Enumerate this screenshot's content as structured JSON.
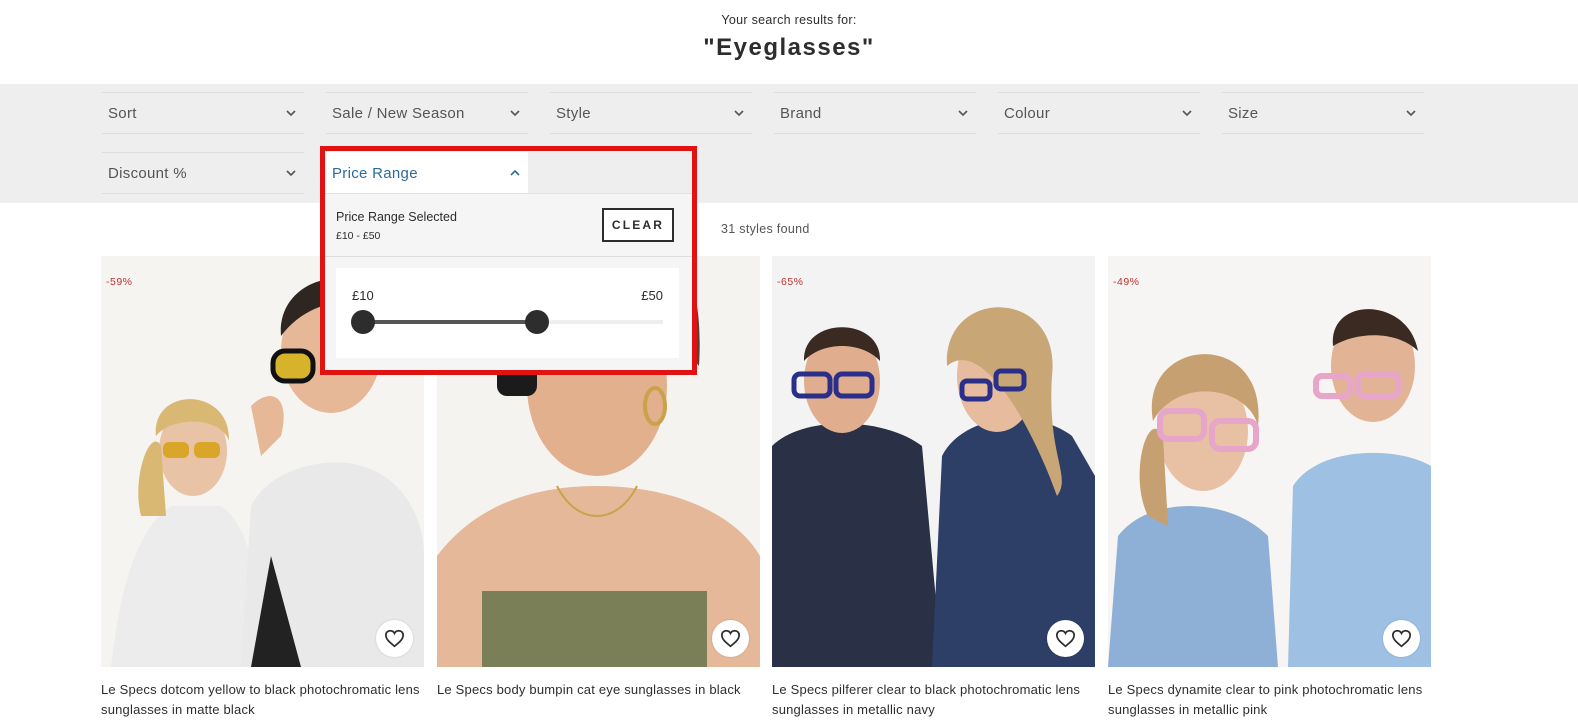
{
  "search": {
    "intro": "Your search results for:",
    "term": "\"Eyeglasses\""
  },
  "filters": [
    {
      "label": "Sort"
    },
    {
      "label": "Sale / New Season"
    },
    {
      "label": "Style"
    },
    {
      "label": "Brand"
    },
    {
      "label": "Colour"
    },
    {
      "label": "Size"
    },
    {
      "label": "Discount %"
    },
    {
      "label": "Price Range"
    }
  ],
  "price_range": {
    "selected_title": "Price Range Selected",
    "selected_value": "£10 - £50",
    "clear_label": "CLEAR",
    "min_label": "£10",
    "max_label": "£50",
    "low_fraction": 0.0,
    "high_fraction": 0.58
  },
  "results": {
    "count_text": "31 styles found"
  },
  "products": [
    {
      "discount": "-59%",
      "title": "Le Specs dotcom yellow to black photochromatic lens sunglasses in matte black"
    },
    {
      "discount": "",
      "title": "Le Specs body bumpin cat eye sunglasses in black"
    },
    {
      "discount": "-65%",
      "title": "Le Specs pilferer clear to black photochromatic lens sunglasses in metallic navy"
    },
    {
      "discount": "-49%",
      "title": "Le Specs dynamite clear to pink photochromatic lens sunglasses in metallic pink"
    }
  ],
  "colors": {
    "accent_blue": "#2c6b9a",
    "highlight_red": "#e01212",
    "discount_red": "#c03030"
  },
  "icons": {
    "filter_chevron": "chevron-down-icon",
    "open_chevron": "chevron-up-icon",
    "wishlist": "heart-icon"
  }
}
